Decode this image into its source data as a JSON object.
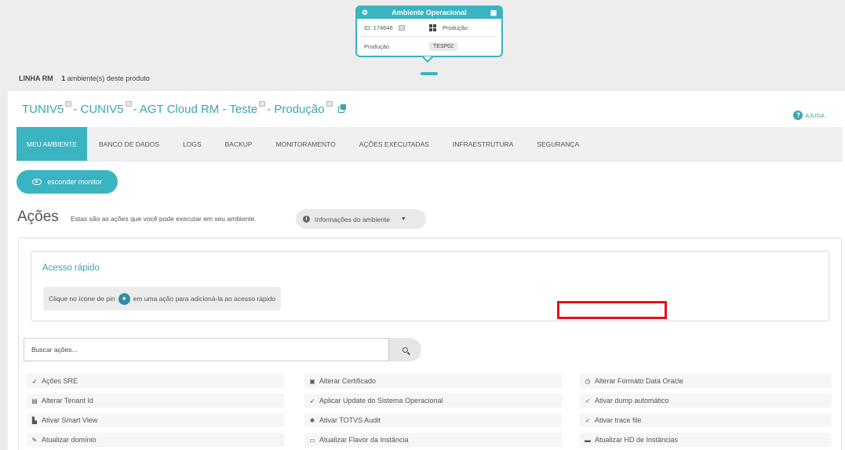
{
  "env_card": {
    "title": "Ambiente Operacional",
    "id_label": "ID: 174646",
    "os_label": "Produção",
    "type_label": "Produção",
    "server_badge": "TESP02"
  },
  "product_line": {
    "name": "LINHA RM",
    "count": "1",
    "count_suffix": "ambiente(s) deste produto"
  },
  "page_title": {
    "segments": [
      "TUNIV5",
      " - CUNIV5",
      " - AGT Cloud RM - Teste",
      " - Produção"
    ]
  },
  "help_label": "AJUDA",
  "tabs": [
    {
      "label": "MEU AMBIENTE"
    },
    {
      "label": "BANCO DE DADOS"
    },
    {
      "label": "LOGS"
    },
    {
      "label": "BACKUP"
    },
    {
      "label": "MONITORAMENTO"
    },
    {
      "label": "AÇÕES EXECUTADAS"
    },
    {
      "label": "INFRAESTRUTURA"
    },
    {
      "label": "SEGURANÇA"
    }
  ],
  "hide_monitor_label": "esconder monitor",
  "actions_section": {
    "title": "Ações",
    "description": "Estas são as ações que você pode executar em seu ambiente.",
    "env_info_label": "Informações do ambiente"
  },
  "quick_access": {
    "title": "Acesso rápido",
    "hint_before": "Clique no ícone de pin",
    "hint_after": "em uma ação para adicioná-la ao acesso rápido"
  },
  "search": {
    "placeholder": "Buscar ações..."
  },
  "actions": [
    [
      "Ações SRE",
      "Alterar Certificado",
      "Alterar Formato Data Oracle"
    ],
    [
      "Alterar Tenant Id",
      "Aplicar Update do Sistema Operacional",
      "Ativar dump automático"
    ],
    [
      "Ativar Smart View",
      "Ativar TOTVS Audit",
      "Ativar trace file"
    ],
    [
      "Atualizar domínio",
      "Atualizar Flavor da Instância",
      "Atualizar HD de Instâncias"
    ]
  ],
  "action_icons": [
    [
      "rocket-icon",
      "lock-icon",
      "clock-icon"
    ],
    [
      "id-card-icon",
      "rocket-icon",
      "check-icon"
    ],
    [
      "chart-icon",
      "bug-icon",
      "check-icon"
    ],
    [
      "wrench-icon",
      "server-icon",
      "hdd-icon"
    ]
  ],
  "colors": {
    "accent": "#3bb4c1",
    "highlight": "#e8101a"
  }
}
